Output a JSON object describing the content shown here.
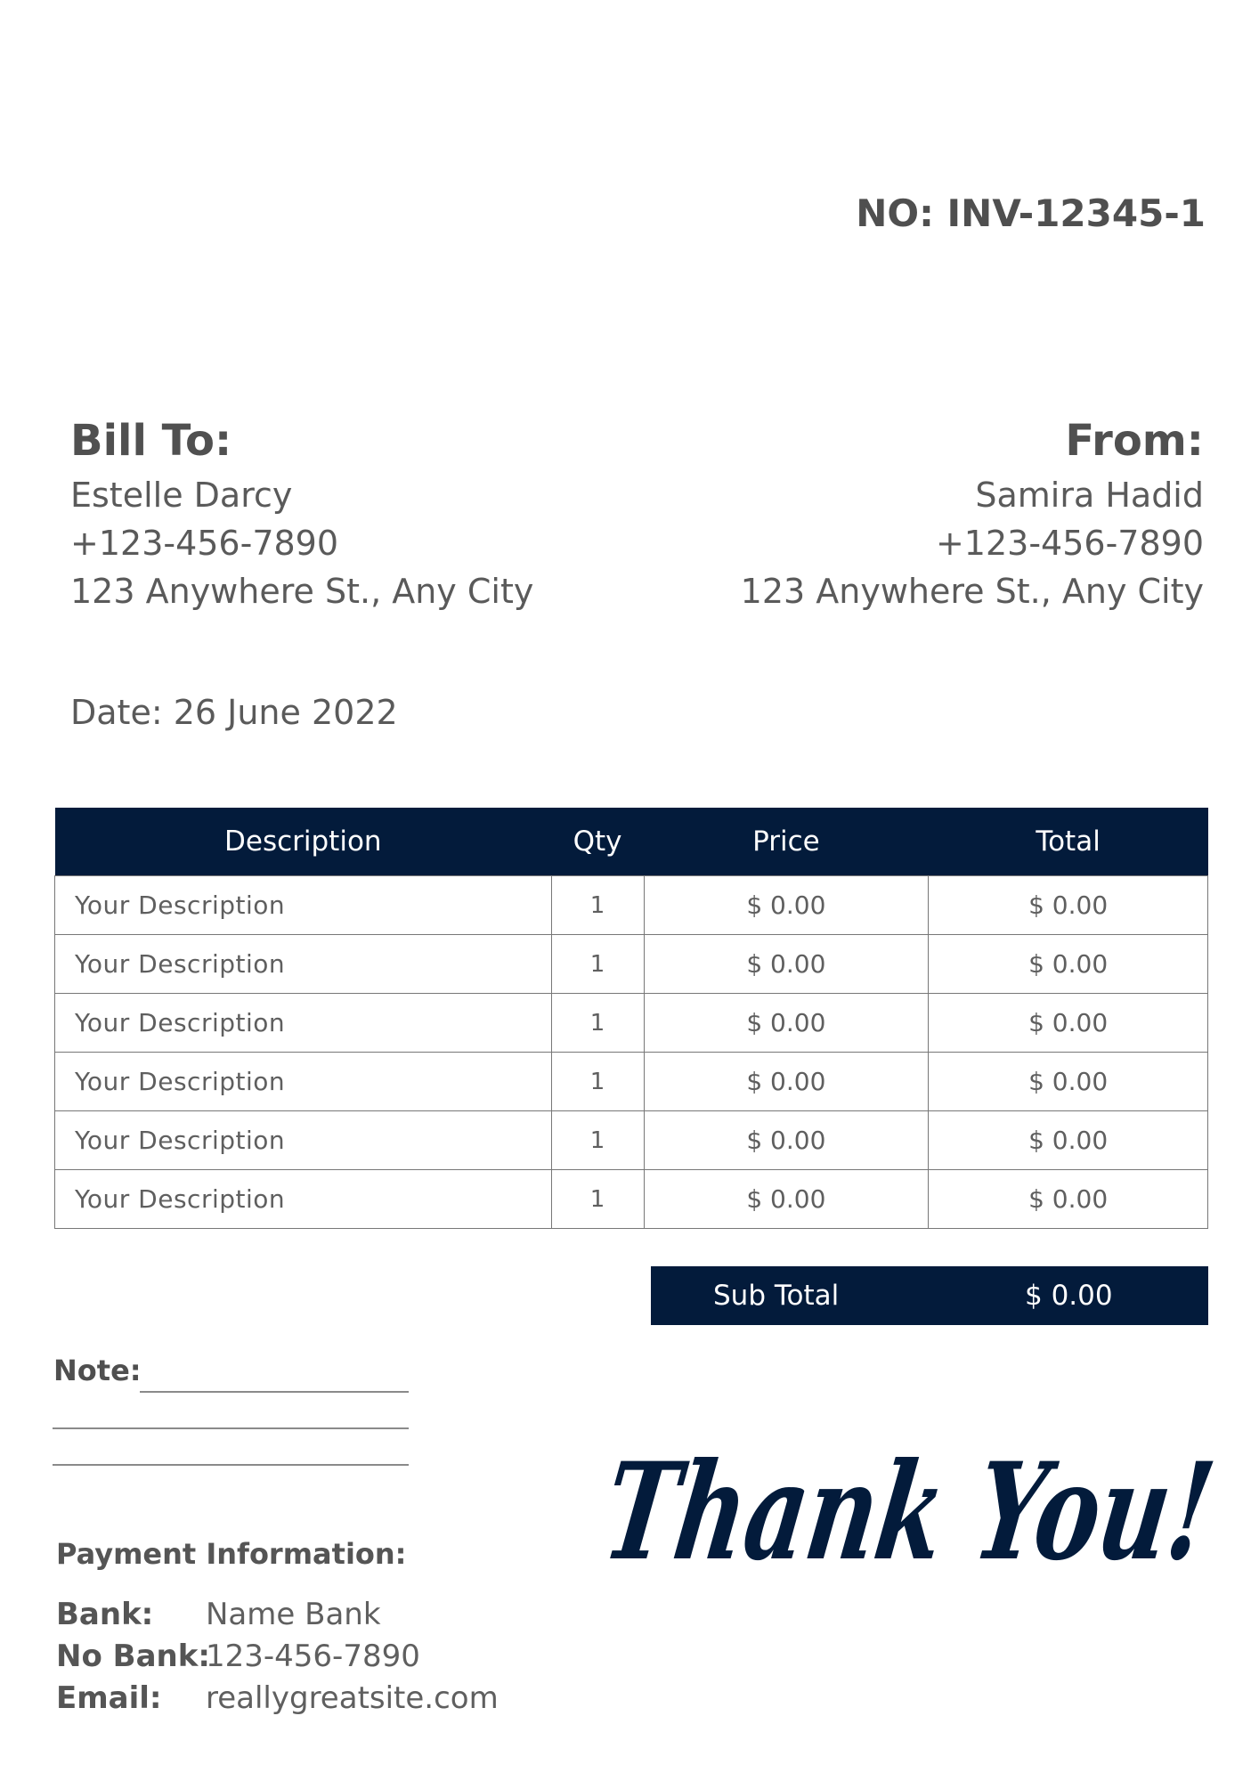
{
  "invoice": {
    "number": "NO: INV-12345-1",
    "date": "Date: 26 June 2022"
  },
  "bill_to": {
    "heading": "Bill To:",
    "name": "Estelle Darcy",
    "phone": "+123-456-7890",
    "address": "123 Anywhere St., Any City"
  },
  "from": {
    "heading": "From:",
    "name": "Samira Hadid",
    "phone": "+123-456-7890",
    "address": "123 Anywhere St., Any City"
  },
  "table": {
    "headers": [
      "Description",
      "Qty",
      "Price",
      "Total"
    ],
    "rows": [
      {
        "description": "Your Description",
        "qty": "1",
        "price": "$ 0.00",
        "total": "$ 0.00"
      },
      {
        "description": "Your Description",
        "qty": "1",
        "price": "$ 0.00",
        "total": "$ 0.00"
      },
      {
        "description": "Your Description",
        "qty": "1",
        "price": "$ 0.00",
        "total": "$ 0.00"
      },
      {
        "description": "Your Description",
        "qty": "1",
        "price": "$ 0.00",
        "total": "$ 0.00"
      },
      {
        "description": "Your Description",
        "qty": "1",
        "price": "$ 0.00",
        "total": "$ 0.00"
      },
      {
        "description": "Your Description",
        "qty": "1",
        "price": "$ 0.00",
        "total": "$ 0.00"
      }
    ]
  },
  "subtotal": {
    "label": "Sub Total",
    "value": "$ 0.00"
  },
  "note": {
    "label": "Note:"
  },
  "payment": {
    "title": "Payment Information:",
    "bank_label": "Bank:",
    "bank_value": "Name Bank",
    "no_bank_label": "No Bank:",
    "no_bank_value": "123-456-7890",
    "email_label": "Email:",
    "email_value": "reallygreatsite.com"
  },
  "closing": {
    "thank_you": "Thank You!"
  },
  "colors": {
    "navy": "#031b3b",
    "text_gray": "#555555"
  }
}
